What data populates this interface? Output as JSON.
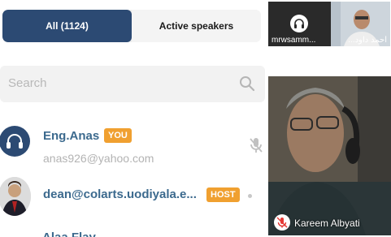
{
  "tabs": {
    "all_label": "All (1124)",
    "active_label": "Active speakers"
  },
  "search": {
    "placeholder": "Search"
  },
  "participants": [
    {
      "name": "Eng.Anas",
      "badge": "YOU",
      "email": "anas926@yahoo.com",
      "mic": "muted"
    },
    {
      "name": "dean@colarts.uodiyala.e...",
      "badge": "HOST"
    },
    {
      "name": "Alaa Flay..."
    }
  ],
  "video": {
    "thumbnails": [
      {
        "label": "mrwsamm..."
      },
      {
        "label": "احمد داود..."
      }
    ],
    "active_speaker": {
      "name": "Kareem Albyati",
      "mic": "muted"
    }
  },
  "colors": {
    "tab_active": "#2c4a73",
    "badge": "#f0a030",
    "name": "#3c6a8e",
    "mic_muted": "#e53935"
  }
}
